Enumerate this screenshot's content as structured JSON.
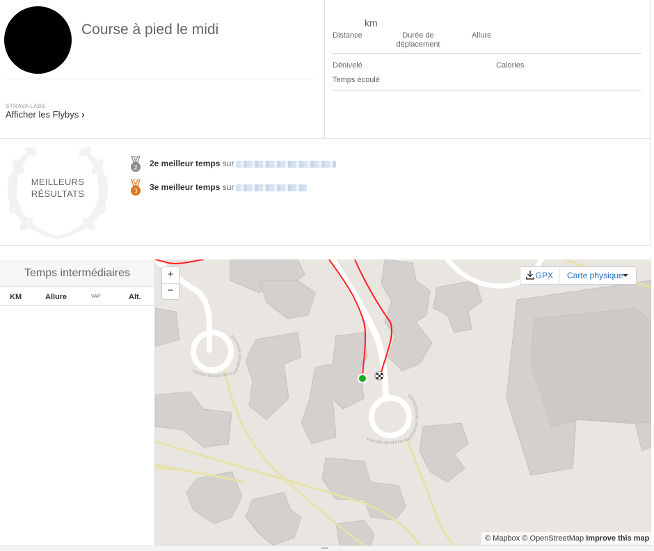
{
  "activity": {
    "title": "Course à pied le midi"
  },
  "labs": {
    "caption": "STRAVA LABS",
    "flyby_label": "Afficher les Flybys",
    "flyby_chevron": "›"
  },
  "stats": {
    "distance_unit": "km",
    "distance_label": "Distance",
    "moving_time_label": "Durée de déplacement",
    "pace_label": "Allure",
    "elevation_label": "Dénivelé",
    "calories_label": "Calories",
    "elapsed_label": "Temps écoulé"
  },
  "achievements": {
    "heading_line1": "MEILLEURS",
    "heading_line2": "RÉSULTATS",
    "items": [
      {
        "rank": "2",
        "text": "2e meilleur temps",
        "connector": "sur",
        "medal_color": "#8c8c8c"
      },
      {
        "rank": "3",
        "text": "3e meilleur temps",
        "connector": "sur",
        "medal_color": "#e0731b"
      }
    ]
  },
  "splits": {
    "title": "Temps intermédiaires",
    "columns": [
      "KM",
      "Allure",
      "VAP",
      "Alt."
    ]
  },
  "map": {
    "zoom_in": "+",
    "zoom_out": "−",
    "gpx_label": "GPX",
    "map_type": "Carte physique",
    "attribution_prefix": "© Mapbox © OpenStreetMap",
    "attribution_link": "Improve this map",
    "route_color": "#ff2020",
    "start_color": "#1eaa1e"
  }
}
